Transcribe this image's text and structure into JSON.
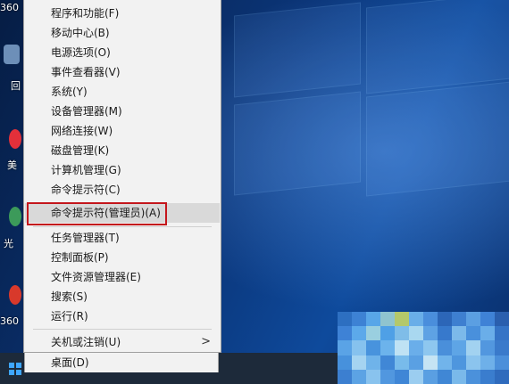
{
  "desktop": {
    "icon_labels": [
      "360",
      "回",
      "美",
      "光",
      "360"
    ]
  },
  "menu": {
    "items": [
      {
        "label": "程序和功能(F)"
      },
      {
        "label": "移动中心(B)"
      },
      {
        "label": "电源选项(O)"
      },
      {
        "label": "事件查看器(V)"
      },
      {
        "label": "系统(Y)"
      },
      {
        "label": "设备管理器(M)"
      },
      {
        "label": "网络连接(W)"
      },
      {
        "label": "磁盘管理(K)"
      },
      {
        "label": "计算机管理(G)"
      },
      {
        "label": "命令提示符(C)"
      },
      {
        "label": "命令提示符(管理员)(A)"
      },
      {
        "label": "任务管理器(T)"
      },
      {
        "label": "控制面板(P)"
      },
      {
        "label": "文件资源管理器(E)"
      },
      {
        "label": "搜索(S)"
      },
      {
        "label": "运行(R)"
      },
      {
        "label": "关机或注销(U)",
        "submenu_arrow": ">"
      },
      {
        "label": "桌面(D)"
      }
    ],
    "highlight_color": "#c4161c"
  },
  "taskbar": {
    "start_icon": "windows-logo-icon",
    "accent": "#3ea6ff"
  }
}
